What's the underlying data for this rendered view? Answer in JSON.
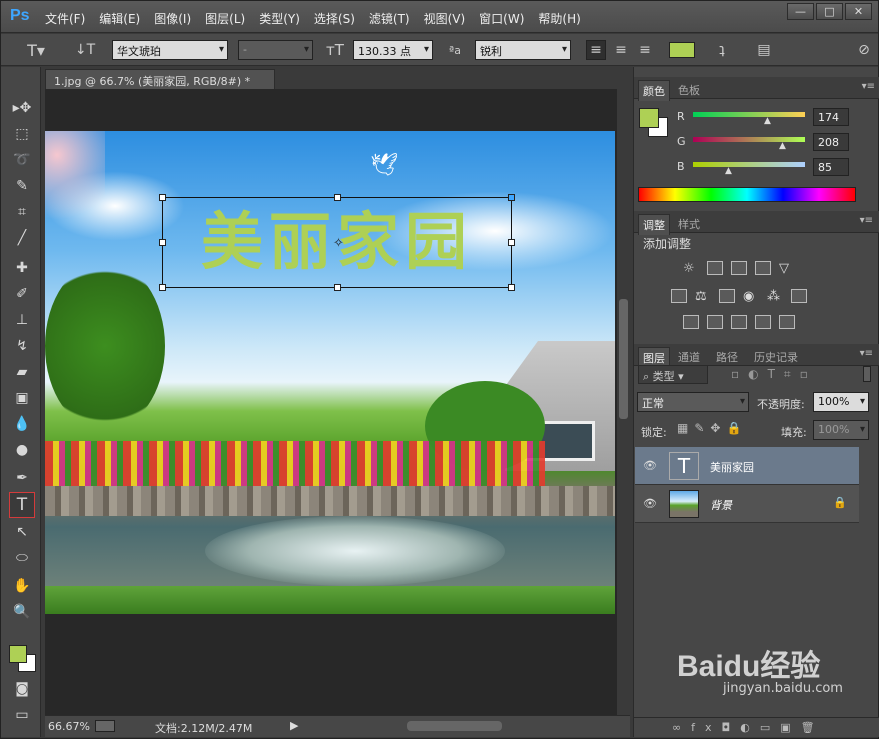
{
  "app": {
    "logo": "Ps"
  },
  "menu": [
    "文件(F)",
    "编辑(E)",
    "图像(I)",
    "图层(L)",
    "类型(Y)",
    "选择(S)",
    "滤镜(T)",
    "视图(V)",
    "窗口(W)",
    "帮助(H)"
  ],
  "window_buttons": {
    "minimize": "—",
    "maximize": "□",
    "close": "✕"
  },
  "options": {
    "font_family": "华文琥珀",
    "font_style": "-",
    "font_size": "130.33 点",
    "antialias": "锐利",
    "color_swatch": "#aed055"
  },
  "document": {
    "tab_title": "1.jpg @ 66.7% (美丽家园, RGB/8#) *",
    "text_layer_content": "美丽家园",
    "zoom": "66.67%",
    "doc_size": "文档:2.12M/2.47M"
  },
  "color_panel": {
    "tabs": [
      "颜色",
      "色板"
    ],
    "r_label": "R",
    "g_label": "G",
    "b_label": "B",
    "r": "174",
    "g": "208",
    "b": "85",
    "fg_color": "#aed055"
  },
  "adjust_panel": {
    "tabs": [
      "调整",
      "样式"
    ],
    "title": "添加调整"
  },
  "layers_panel": {
    "tabs": [
      "图层",
      "通道",
      "路径",
      "历史记录"
    ],
    "filter_label": "类型",
    "blend_mode": "正常",
    "opacity_label": "不透明度:",
    "opacity": "100%",
    "lock_label": "锁定:",
    "fill_label": "填充:",
    "fill": "100%",
    "layers": [
      {
        "name": "美丽家园",
        "type": "text"
      },
      {
        "name": "背景",
        "type": "image"
      }
    ]
  },
  "watermark": {
    "brand": "Baidu经验",
    "site": "jingyan.baidu.com"
  }
}
